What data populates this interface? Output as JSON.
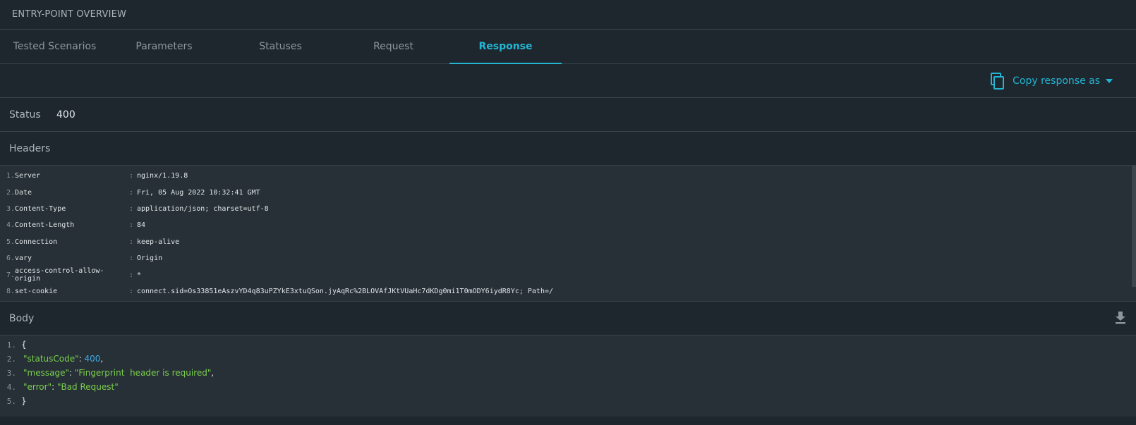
{
  "window": {
    "title": "ENTRY-POINT OVERVIEW"
  },
  "tabs": [
    {
      "label": "Tested Scenarios",
      "active": false
    },
    {
      "label": "Parameters",
      "active": false
    },
    {
      "label": "Statuses",
      "active": false
    },
    {
      "label": "Request",
      "active": false
    },
    {
      "label": "Response",
      "active": true
    }
  ],
  "toolbar": {
    "copy_label": "Copy response as",
    "copy_icon": "copy-icon",
    "dropdown_icon": "caret-down-icon"
  },
  "status": {
    "label": "Status",
    "value": "400"
  },
  "headers": {
    "title": "Headers",
    "rows": [
      {
        "n": "1.",
        "key": "Server",
        "value": "nginx/1.19.8"
      },
      {
        "n": "2.",
        "key": "Date",
        "value": "Fri, 05 Aug 2022 10:32:41 GMT"
      },
      {
        "n": "3.",
        "key": "Content-Type",
        "value": "application/json; charset=utf-8"
      },
      {
        "n": "4.",
        "key": "Content-Length",
        "value": "84"
      },
      {
        "n": "5.",
        "key": "Connection",
        "value": "keep-alive"
      },
      {
        "n": "6.",
        "key": "vary",
        "value": "Origin"
      },
      {
        "n": "7.",
        "key": "access-control-allow-origin",
        "value": "*"
      },
      {
        "n": "8.",
        "key": "set-cookie",
        "value": "connect.sid=Os33851eAszvYD4q83uPZYkE3xtuQSon.jyAqRc%2BLOVAfJKtVUaHc7dKDg0mi1T0mODY6iydR8Yc; Path=/"
      }
    ],
    "separator": ":"
  },
  "body": {
    "title": "Body",
    "download_icon": "download-icon",
    "lines": {
      "l1": {
        "n": "1.",
        "text": "{"
      },
      "l2": {
        "n": "2.",
        "key": "\"statusCode\"",
        "colon": ": ",
        "value": "400",
        "comma": ","
      },
      "l3": {
        "n": "3.",
        "key": "\"message\"",
        "colon": ": ",
        "value": "\"Fingerprint  header is required\"",
        "comma": ","
      },
      "l4": {
        "n": "4.",
        "key": "\"error\"",
        "colon": ": ",
        "value": "\"Bad Request\""
      },
      "l5": {
        "n": "5.",
        "text": "}"
      }
    }
  },
  "colors": {
    "accent": "#23b5d3",
    "background": "#1e272e",
    "panel": "#263036",
    "json_string": "#7ccf4f",
    "json_number": "#3fa9e6"
  }
}
